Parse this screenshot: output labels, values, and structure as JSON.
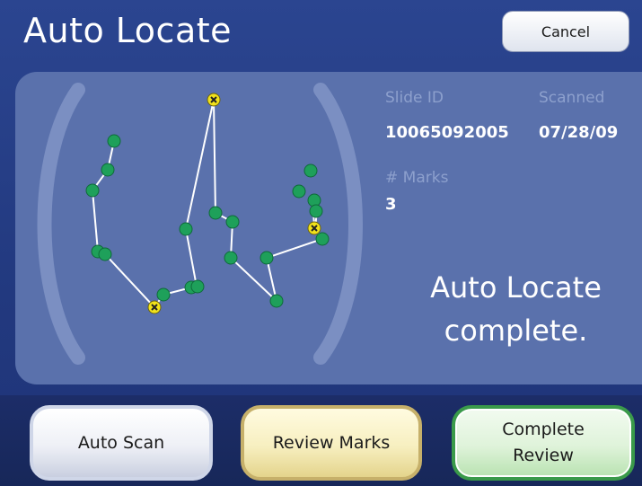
{
  "header": {
    "title": "Auto Locate",
    "cancel_label": "Cancel"
  },
  "slide_info": {
    "slide_id_label": "Slide ID",
    "slide_id_value": "10065092005",
    "scanned_label": "Scanned",
    "scanned_value": "07/28/09",
    "marks_label": "# Marks",
    "marks_value": "3"
  },
  "status": {
    "line1": "Auto Locate",
    "line2": "complete."
  },
  "actions": {
    "auto_scan_label": "Auto Scan",
    "review_marks_label": "Review Marks",
    "complete_review_label": "Complete Review"
  },
  "colors": {
    "panel": "#5a71ac",
    "field_marker": "#1ea05a",
    "mark_marker": "#f2e21a",
    "path_line": "#ffffff"
  }
}
